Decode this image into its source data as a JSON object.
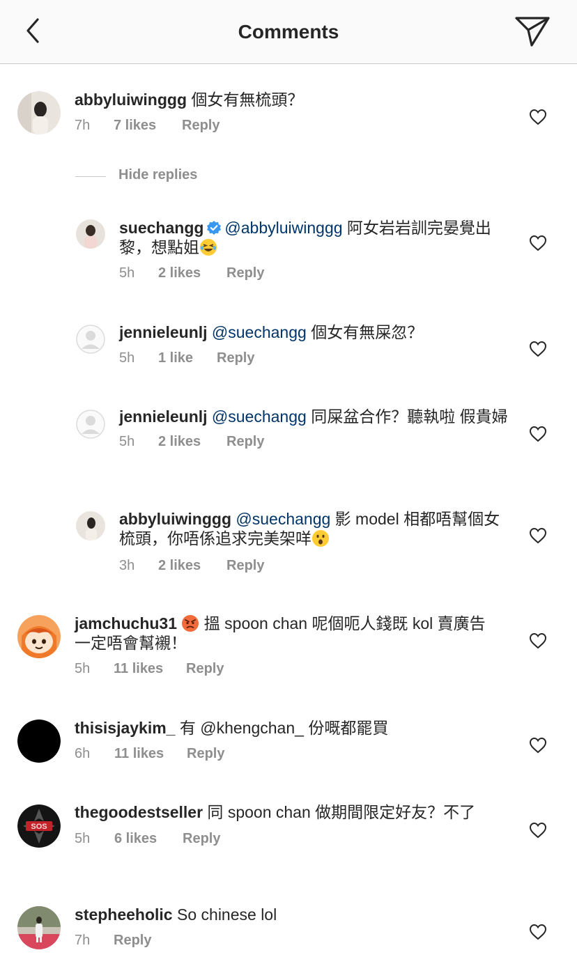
{
  "header": {
    "title": "Comments"
  },
  "hide_replies_label": "Hide replies",
  "comments": [
    {
      "user": "abbyluiwinggg",
      "text": " 個女有無梳頭？",
      "time": "7h",
      "likes": "7 likes",
      "reply": "Reply"
    },
    {
      "user": "jamchuchu31",
      "text_a": " ",
      "text_b": " 搵 spoon chan 呢個呃人錢既 kol 賣廣告 一定唔會幫襯！",
      "time": "5h",
      "likes": "11 likes",
      "reply": "Reply"
    },
    {
      "user": "thisisjaykim_",
      "text": " 有 @khengchan_ 份嘅都罷買",
      "time": "6h",
      "likes": "11 likes",
      "reply": "Reply"
    },
    {
      "user": "thegoodestseller",
      "text": " 同 spoon chan 做期間限定好友？不了",
      "time": "5h",
      "likes": "6 likes",
      "reply": "Reply"
    },
    {
      "user": "stepheeholic",
      "text": " So chinese lol",
      "time": "7h",
      "reply": "Reply"
    }
  ],
  "replies": [
    {
      "user": "suechangg",
      "mention": "@abbyluiwinggg",
      "text": " 阿女岩岩訓完晏覺出黎，想點姐",
      "time": "5h",
      "likes": "2 likes",
      "reply": "Reply"
    },
    {
      "user": "jennieleunlj",
      "mention": "@suechangg",
      "text": " 個女有無屎忽？",
      "time": "5h",
      "likes": "1 like",
      "reply": "Reply"
    },
    {
      "user": "jennieleunlj",
      "mention": "@suechangg",
      "text": " 同屎盆合作？聽執啦 假貴婦",
      "time": "5h",
      "likes": "2 likes",
      "reply": "Reply"
    },
    {
      "user": "abbyluiwinggg",
      "mention": "@suechangg",
      "text": " 影 model 相都唔幫個女梳頭，你唔係追求完美架咩",
      "time": "3h",
      "likes": "2 likes",
      "reply": "Reply"
    }
  ],
  "colors": {
    "mention": "#003569",
    "meta": "#8e8e8e",
    "verified": "#3897f0"
  },
  "icons": [
    "back-chevron-icon",
    "send-icon",
    "heart-outline-icon",
    "verified-badge-icon",
    "laughing-emoji-icon",
    "angry-emoji-icon",
    "surprised-emoji-icon"
  ]
}
